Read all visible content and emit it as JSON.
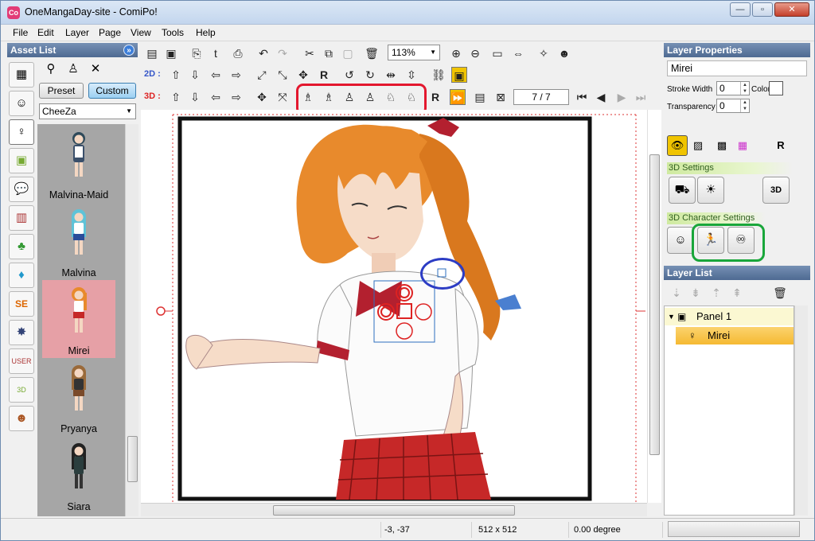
{
  "window": {
    "title": "OneMangaDay-site - ComiPo!",
    "app_icon": "comipo-icon",
    "controls": {
      "minimize": "—",
      "maximize": "▫",
      "close": "✕"
    }
  },
  "menu": [
    "File",
    "Edit",
    "Layer",
    "Page",
    "View",
    "Tools",
    "Help"
  ],
  "asset_panel": {
    "title": "Asset List",
    "help": "»",
    "tabs": [
      "character",
      "3d-object",
      "speech-balloon",
      "background",
      "tree",
      "drop",
      "sound-effect",
      "effect",
      "user-data",
      "3d-user-data",
      "user-character"
    ],
    "preset_label": "Preset",
    "custom_label": "Custom",
    "custom_selected": true,
    "filter_value": "CheeZa",
    "items": [
      {
        "name": "Malvina-Maid",
        "selected": false
      },
      {
        "name": "Malvina",
        "selected": false
      },
      {
        "name": "Mirei",
        "selected": true
      },
      {
        "name": "Pryanya",
        "selected": false
      },
      {
        "name": "Siara",
        "selected": false
      }
    ]
  },
  "toolbar": {
    "zoom_value": "113%",
    "label_2d": "2D :",
    "label_3d": "3D :",
    "page_counter": "7 / 7"
  },
  "canvas": {
    "panel_name": "Panel 1",
    "hair_color": "#e88a2c",
    "skirt_color": "#c62828",
    "frame_color": "#111111"
  },
  "layer_properties": {
    "title": "Layer Properties",
    "name_value": "Mirei",
    "stroke_width_label": "Stroke Width",
    "stroke_width_value": "0",
    "color_label": "Color",
    "transparency_label": "Transparency",
    "transparency_value": "0",
    "section_3d_settings": "3D Settings",
    "section_3d_character_settings": "3D Character Settings"
  },
  "layer_list": {
    "title": "Layer List",
    "rows": [
      {
        "label": "Panel 1",
        "type": "panel",
        "selected": false
      },
      {
        "label": "Mirei",
        "type": "character",
        "selected": true
      }
    ]
  },
  "status": {
    "coordinates": "-3, -37",
    "size": "512 x 512",
    "rotation": "0.00 degree"
  },
  "colors": {
    "accent_blue": "#4e6a92",
    "highlight_red": "#e3172e",
    "highlight_green": "#19a63a",
    "highlight_blue": "#2c3cc4",
    "selected_layer": "#f5b932"
  }
}
